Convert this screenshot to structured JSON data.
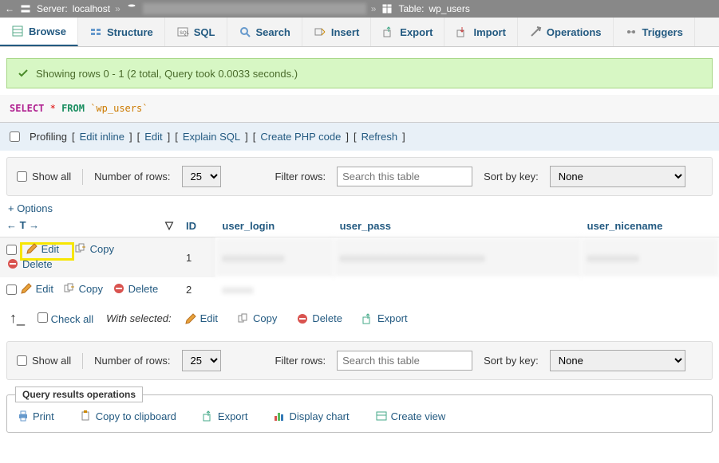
{
  "breadcrumb": {
    "server_label": "Server:",
    "server_value": "localhost",
    "db_label": "Database:",
    "table_label": "Table:",
    "table_value": "wp_users"
  },
  "tabs": {
    "browse": "Browse",
    "structure": "Structure",
    "sql": "SQL",
    "search": "Search",
    "insert": "Insert",
    "export": "Export",
    "import": "Import",
    "operations": "Operations",
    "triggers": "Triggers"
  },
  "success": {
    "msg": "Showing rows 0 - 1 (2 total, Query took 0.0033 seconds.)"
  },
  "sql": {
    "select": "SELECT",
    "star": "*",
    "from": "FROM",
    "table": "`wp_users`"
  },
  "links": {
    "profiling": "Profiling",
    "editinline": "Edit inline",
    "edit": "Edit",
    "explain": "Explain SQL",
    "createphp": "Create PHP code",
    "refresh": "Refresh"
  },
  "nav": {
    "showall": "Show all",
    "numrows": "Number of rows:",
    "rowopts": "25",
    "filter": "Filter rows:",
    "searchph": "Search this table",
    "sortkey": "Sort by key:",
    "none": "None"
  },
  "options": "+ Options",
  "cols": {
    "id": "ID",
    "user_login": "user_login",
    "user_pass": "user_pass",
    "user_nicename": "user_nicename"
  },
  "row": {
    "edit": "Edit",
    "copy": "Copy",
    "delete": "Delete",
    "id1": "1",
    "id2": "2"
  },
  "withsel": {
    "checkall": "Check all",
    "label": "With selected:",
    "edit": "Edit",
    "copy": "Copy",
    "delete": "Delete",
    "export": "Export"
  },
  "panel": {
    "title": "Query results operations",
    "print": "Print",
    "copyclip": "Copy to clipboard",
    "export": "Export",
    "chart": "Display chart",
    "createview": "Create view"
  }
}
